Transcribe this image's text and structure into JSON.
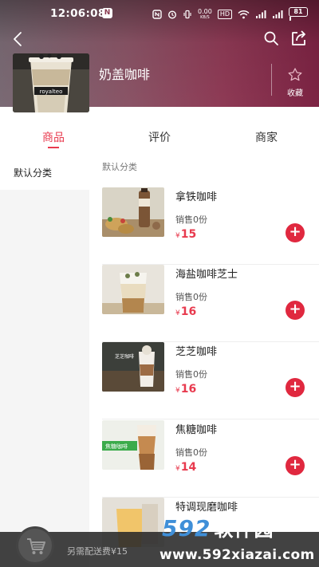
{
  "status_bar": {
    "time": "12:06:08",
    "notification_badge": "N",
    "net_speed_value": "0.00",
    "net_speed_unit": "KB/S",
    "hd": "HD",
    "battery": "81"
  },
  "header": {
    "shop_name": "奶盖咖啡",
    "favorite_label": "收藏",
    "logo_text": "royalteo"
  },
  "tabs": [
    {
      "label": "商品",
      "active": true
    },
    {
      "label": "评价",
      "active": false
    },
    {
      "label": "商家",
      "active": false
    }
  ],
  "sidebar": {
    "items": [
      {
        "label": "默认分类",
        "selected": true
      }
    ]
  },
  "menu": {
    "category_title": "默认分类",
    "products": [
      {
        "name": "拿铁咖啡",
        "sales": "销售0份",
        "currency": "¥",
        "price": "15",
        "image": "latte-photo",
        "image_text": ""
      },
      {
        "name": "海盐咖啡芝士",
        "sales": "销售0份",
        "currency": "¥",
        "price": "16",
        "image": "sea-salt-cheese-photo",
        "image_text": ""
      },
      {
        "name": "芝芝咖啡",
        "sales": "销售0份",
        "currency": "¥",
        "price": "16",
        "image": "cheese-coffee-photo",
        "image_text": "芝芝咖啡"
      },
      {
        "name": "焦糖咖啡",
        "sales": "销售0份",
        "currency": "¥",
        "price": "14",
        "image": "caramel-coffee-photo",
        "image_text": "焦糖咖啡"
      },
      {
        "name": "特调现磨咖啡",
        "sales": "",
        "currency": "",
        "price": "",
        "image": "special-coffee-photo",
        "image_text": ""
      }
    ],
    "add_symbol": "+"
  },
  "cart": {
    "delivery_fee_text": "另需配送费¥15"
  },
  "watermark": {
    "number": "592",
    "brand": "软件园",
    "url": "www.592xiazai.com"
  },
  "colors": {
    "accent": "#e83a4e",
    "header_start": "#7a6a74",
    "header_end": "#7c2343"
  }
}
